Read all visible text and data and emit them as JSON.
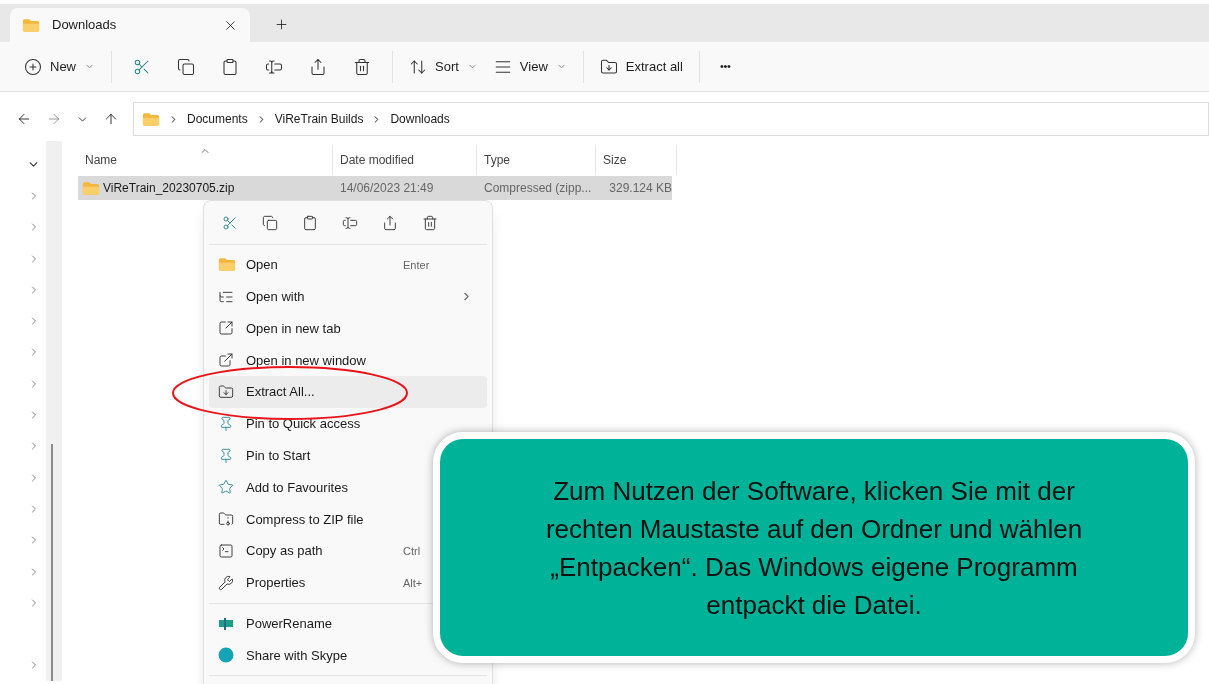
{
  "tabs": [
    {
      "label": "Downloads",
      "selected": true
    }
  ],
  "toolbar": [
    {
      "kind": "menu",
      "label": "New"
    },
    {
      "kind": "icon"
    },
    {
      "kind": "icon"
    },
    {
      "kind": "icon"
    },
    {
      "kind": "icon"
    },
    {
      "kind": "icon"
    },
    {
      "kind": "icon"
    },
    {
      "kind": "menu",
      "label": "Sort"
    },
    {
      "kind": "menu",
      "label": "View"
    },
    {
      "kind": "button",
      "label": "Extract all"
    },
    {
      "kind": "more",
      "label": "•••"
    }
  ],
  "breadcrumbs": [
    "Documents",
    "ViReTrain Builds",
    "Downloads"
  ],
  "nav_tree": [
    {
      "kind": "folder",
      "expanded": true
    },
    {
      "kind": "folder",
      "expanded": false
    },
    {
      "kind": "folder",
      "expanded": false
    },
    {
      "kind": "folder",
      "expanded": false
    },
    {
      "kind": "folder",
      "expanded": false
    },
    {
      "kind": "folder",
      "expanded": false
    },
    {
      "kind": "folder",
      "expanded": false
    },
    {
      "kind": "folder",
      "expanded": false
    },
    {
      "kind": "folder",
      "expanded": false
    },
    {
      "kind": "folder",
      "expanded": false
    },
    {
      "kind": "folder",
      "expanded": false
    },
    {
      "kind": "folder",
      "expanded": false
    },
    {
      "kind": "folder",
      "expanded": false
    },
    {
      "kind": "folder",
      "expanded": false
    },
    {
      "kind": "folder",
      "expanded": false
    },
    {
      "kind": "leaf"
    },
    {
      "kind": "folder",
      "expanded": false
    }
  ],
  "table": {
    "columns": [
      {
        "label": "Name",
        "sorted": true
      },
      {
        "label": "Date modified",
        "sorted": false
      },
      {
        "label": "Type",
        "sorted": false
      },
      {
        "label": "Size",
        "sorted": false
      }
    ],
    "rows": [
      {
        "name": "ViReTrain_20230705.zip",
        "date": "14/06/2023 21:49",
        "type": "Compressed (zipp...",
        "size": "329.124 KB",
        "selected": true
      }
    ]
  },
  "context_menu": {
    "groups": [
      [
        {
          "label": "Open",
          "shortcut": "Enter",
          "submenu": false,
          "selected": false
        },
        {
          "label": "Open with",
          "submenu": true,
          "selected": false
        },
        {
          "label": "Open in new tab",
          "submenu": false,
          "selected": false
        },
        {
          "label": "Open in new window",
          "submenu": false,
          "selected": false
        },
        {
          "label": "Extract All...",
          "submenu": false,
          "selected": true
        },
        {
          "label": "Pin to Quick access",
          "submenu": false,
          "selected": false
        },
        {
          "label": "Pin to Start",
          "submenu": false,
          "selected": false
        },
        {
          "label": "Add to Favourites",
          "submenu": false,
          "selected": false
        },
        {
          "label": "Compress to ZIP file",
          "submenu": false,
          "selected": false
        },
        {
          "label": "Copy as path",
          "shortcut": "Ctrl",
          "submenu": false,
          "selected": false
        },
        {
          "label": "Properties",
          "shortcut": "Alt+",
          "submenu": false,
          "selected": false
        }
      ],
      [
        {
          "label": "PowerRename",
          "submenu": false,
          "selected": false
        },
        {
          "label": "Share with Skype",
          "submenu": false,
          "selected": false
        }
      ]
    ]
  },
  "callout": {
    "text": "Zum Nutzen der Software, klicken Sie mit der rechten Maustaste auf den Ordner und wählen „Entpacken“. Das Windows eigene Programm entpackt die Datei."
  }
}
